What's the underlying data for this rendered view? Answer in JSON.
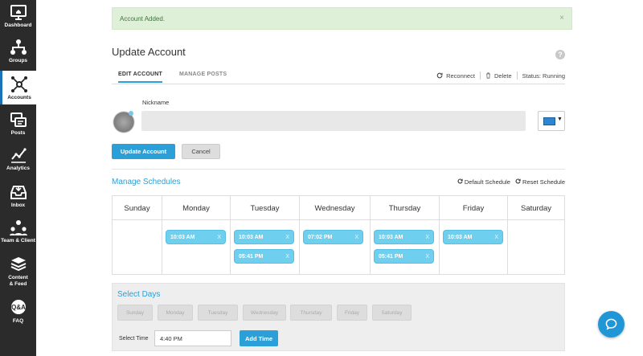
{
  "sidebar": {
    "items": [
      {
        "label": "Dashboard",
        "icon": "monitor-home-icon"
      },
      {
        "label": "Groups",
        "icon": "hierarchy-icon"
      },
      {
        "label": "Accounts",
        "icon": "network-nodes-icon",
        "active": true
      },
      {
        "label": "Posts",
        "icon": "posts-icon"
      },
      {
        "label": "Analytics",
        "icon": "line-chart-icon"
      },
      {
        "label": "Inbox",
        "icon": "inbox-tray-icon"
      },
      {
        "label": "Team & Client",
        "icon": "team-icon"
      },
      {
        "label": "Content & Feed",
        "icon": "layers-icon"
      },
      {
        "label": "FAQ",
        "icon": "qa-bubble-icon"
      }
    ]
  },
  "alert": {
    "message": "Account Added.",
    "close": "×"
  },
  "page": {
    "title": "Update Account",
    "help": "?"
  },
  "tabs": {
    "edit": "EDIT ACCOUNT",
    "posts": "MANAGE POSTS",
    "reconnect": "Reconnect",
    "delete": "Delete",
    "status": "Status: Running"
  },
  "form": {
    "nickname_label": "Nickname",
    "nickname_value": "",
    "color": "#2e86d0",
    "update_label": "Update Account",
    "cancel_label": "Cancel"
  },
  "schedules": {
    "title": "Manage Schedules",
    "default_label": "Default Schedule",
    "reset_label": "Reset Schedule",
    "days": [
      "Sunday",
      "Monday",
      "Tuesday",
      "Wednesday",
      "Thursday",
      "Friday",
      "Saturday"
    ],
    "slots": {
      "monday": [
        "10:03 AM"
      ],
      "tuesday": [
        "10:03 AM",
        "05:41 PM"
      ],
      "wednesday": [
        "07:02 PM"
      ],
      "thursday": [
        "10:03 AM",
        "05:41 PM"
      ],
      "friday": [
        "10:03 AM"
      ]
    },
    "remove": "X"
  },
  "select_days": {
    "title": "Select Days",
    "days": [
      "Sunday",
      "Monday",
      "Tuesday",
      "Wednesday",
      "Thursday",
      "Friday",
      "Saturday"
    ],
    "time_label": "Select Time",
    "time_value": "4:40 PM",
    "add_label": "Add Time"
  },
  "colors": {
    "accent": "#2a9fd8",
    "slot": "#6fcfee",
    "sidebar": "#2b2b2b",
    "alert_bg": "#dff0d8"
  }
}
